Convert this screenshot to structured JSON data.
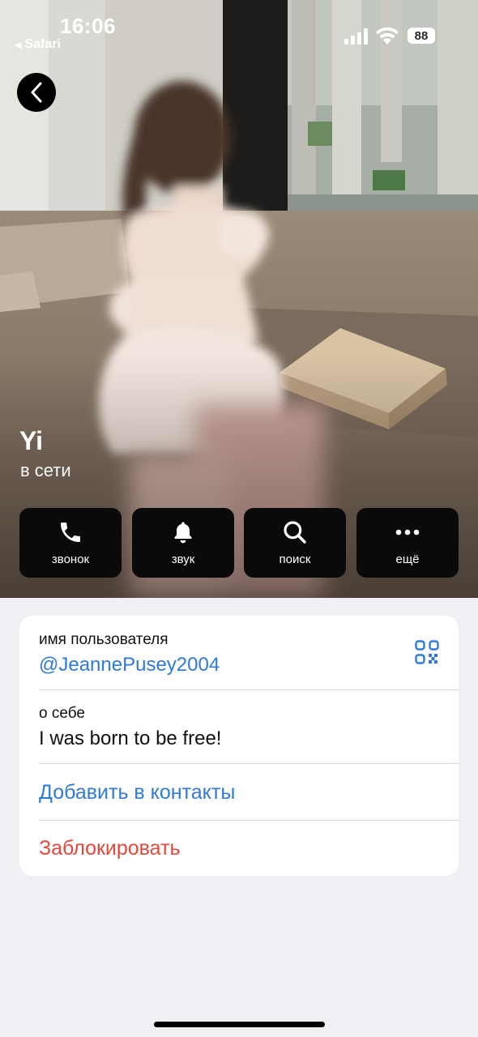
{
  "status_bar": {
    "time": "16:06",
    "back_app": "Safari",
    "battery": "88",
    "icons": [
      "signal-icon",
      "wifi-icon",
      "battery-icon"
    ]
  },
  "profile": {
    "name": "Yi",
    "status": "в сети"
  },
  "actions": [
    {
      "label": "звонок",
      "icon": "phone-icon"
    },
    {
      "label": "звук",
      "icon": "bell-icon"
    },
    {
      "label": "поиск",
      "icon": "search-icon"
    },
    {
      "label": "ещё",
      "icon": "more-icon"
    }
  ],
  "info": {
    "username_label": "имя пользователя",
    "username": "@JeannePusey2004",
    "about_label": "о себе",
    "about": "I was born to be free!",
    "add_contact": "Добавить в контакты",
    "block": "Заблокировать"
  },
  "colors": {
    "link": "#2f7ad6",
    "danger": "#e5483b",
    "background": "#efeff4"
  }
}
